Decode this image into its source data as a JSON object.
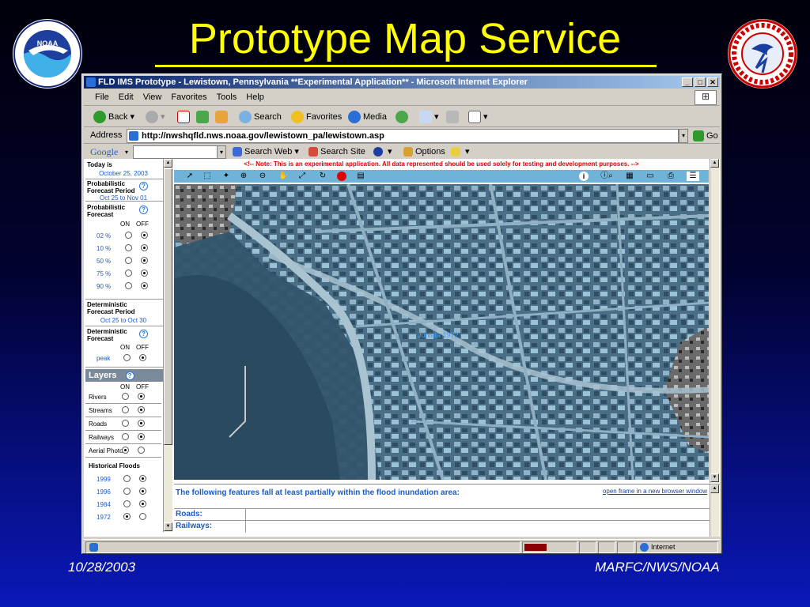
{
  "slide": {
    "title": "Prototype Map Service",
    "footer_left": "10/28/2003",
    "footer_right": "MARFC/NWS/NOAA"
  },
  "browser": {
    "title": "FLD IMS Prototype - Lewistown, Pennsylvania **Experimental Application** - Microsoft Internet Explorer",
    "menu": [
      "File",
      "Edit",
      "View",
      "Favorites",
      "Tools",
      "Help"
    ],
    "toolbar": {
      "back": "Back",
      "search": "Search",
      "favorites": "Favorites",
      "media": "Media"
    },
    "address_label": "Address",
    "address": "http://nwshqfld.nws.noaa.gov/lewistown_pa/lewistown.asp",
    "go": "Go",
    "google": {
      "logo": "Google",
      "search_web": "Search Web",
      "search_site": "Search Site",
      "options": "Options"
    },
    "status": {
      "zone": "Internet"
    }
  },
  "left_panel": {
    "today_label": "Today is",
    "today_date": "October 25, 2003",
    "prob_period_label": "Probabilistic Forecast Period",
    "prob_period_value": "Oct 25 to Nov 01",
    "prob_forecast_label": "Probabilistic Forecast",
    "on": "ON",
    "off": "OFF",
    "prob_levels": [
      {
        "label": "02 %",
        "on": false
      },
      {
        "label": "10 %",
        "on": false
      },
      {
        "label": "50 %",
        "on": false
      },
      {
        "label": "75 %",
        "on": false
      },
      {
        "label": "90 %",
        "on": false
      }
    ],
    "det_period_label": "Deterministic Forecast Period",
    "det_period_value": "Oct 25 to Oct 30",
    "det_forecast_label": "Deterministic Forecast",
    "peak_label": "peak",
    "layers_title": "Layers",
    "layers": [
      {
        "label": "Rivers",
        "on": false
      },
      {
        "label": "Streams",
        "on": false
      },
      {
        "label": "Roads",
        "on": false
      },
      {
        "label": "Railways",
        "on": false
      },
      {
        "label": "Aerial Photo",
        "on": true
      }
    ],
    "hist_title": "Historical Floods",
    "floods": [
      {
        "label": "1999",
        "on": false
      },
      {
        "label": "1996",
        "on": false
      },
      {
        "label": "1984",
        "on": false
      },
      {
        "label": "1972",
        "on": true
      }
    ]
  },
  "map": {
    "note": "<!-- Note: This is an experimental application. All data represented should be used solely for testing and development purposes. -->",
    "flood_label": "Juniata 1972"
  },
  "features": {
    "title": "The following features fall at least partially within the flood inundation area:",
    "open_frame": "open frame in a new browser window",
    "rows": [
      "Roads:",
      "Railways:"
    ]
  },
  "colors": {
    "slide_title": "#ffff00",
    "flood_overlay": "#6fb4d8",
    "link_blue": "#1a5bc9",
    "note_red": "#e00000"
  }
}
